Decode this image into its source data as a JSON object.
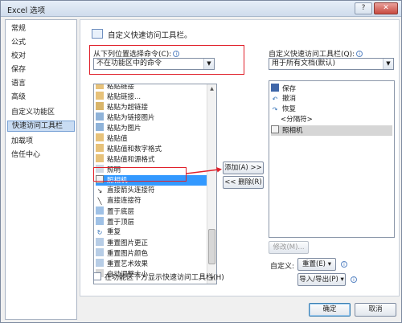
{
  "window": {
    "title": "Excel 选项",
    "help_glyph": "?",
    "close_glyph": "✕"
  },
  "sidebar": {
    "items": [
      {
        "label": "常规"
      },
      {
        "label": "公式"
      },
      {
        "label": "校对"
      },
      {
        "label": "保存"
      },
      {
        "label": "语言"
      },
      {
        "label": "高级"
      },
      {
        "label": "自定义功能区"
      },
      {
        "label": "快速访问工具栏",
        "active": true
      },
      {
        "label": "加载项"
      },
      {
        "label": "信任中心"
      }
    ]
  },
  "main": {
    "header_title": "自定义快速访问工具栏。",
    "choose_label": "从下列位置选择命令(C):",
    "choose_value": "不在功能区中的命令",
    "customize_label": "自定义快速访问工具栏(Q):",
    "customize_value": "用于所有文档(默认)",
    "commands": [
      {
        "label": "粘贴链接",
        "icon": "paste-link-icon"
      },
      {
        "label": "粘贴链接...",
        "icon": "paste-link-icon"
      },
      {
        "label": "粘贴为超链接",
        "icon": "paste-hyperlink-icon"
      },
      {
        "label": "粘贴为链接图片",
        "icon": "paste-picture-link-icon"
      },
      {
        "label": "粘贴为图片",
        "icon": "paste-picture-icon"
      },
      {
        "label": "粘贴值",
        "icon": "paste-values-icon"
      },
      {
        "label": "粘贴值和数字格式",
        "icon": "paste-values-number-icon"
      },
      {
        "label": "粘贴值和源格式",
        "icon": "paste-values-source-icon"
      },
      {
        "label": "照明",
        "icon": "lighting-icon"
      },
      {
        "label": "照相机",
        "icon": "camera-icon",
        "selected": true
      },
      {
        "label": "直接箭头连接符",
        "icon": "straight-arrow-connector-icon"
      },
      {
        "label": "直接连接符",
        "icon": "straight-connector-icon"
      },
      {
        "label": "置于底层",
        "icon": "send-to-back-icon"
      },
      {
        "label": "置于顶层",
        "icon": "bring-to-front-icon"
      },
      {
        "label": "重复",
        "icon": "repeat-icon"
      },
      {
        "label": "重置图片更正",
        "icon": "reset-picture-correction-icon"
      },
      {
        "label": "重置图片颜色",
        "icon": "reset-picture-color-icon"
      },
      {
        "label": "重置艺术效果",
        "icon": "reset-artistic-effects-icon"
      },
      {
        "label": "自动调整大小",
        "icon": "autofit-icon"
      }
    ],
    "toolbar_items": [
      {
        "label": "保存",
        "icon": "save-icon"
      },
      {
        "label": "撤消",
        "icon": "undo-icon"
      },
      {
        "label": "恢复",
        "icon": "redo-icon"
      },
      {
        "label": "<分隔符>",
        "icon": ""
      },
      {
        "label": "照相机",
        "icon": "camera-icon",
        "selected": true
      }
    ],
    "add_label": "添加(A) >>",
    "remove_label": "<< 删除(R)",
    "modify_label": "修改(M)...",
    "customize_text": "自定义:",
    "reset_label": "重置(E) ▾",
    "import_export_label": "导入/导出(P) ▾",
    "show_below_label": "在功能区下方显示快速访问工具栏(H)",
    "info_glyph": "i"
  },
  "footer": {
    "ok_label": "确定",
    "cancel_label": "取消"
  },
  "colors": {
    "selection": "#3399ff",
    "highlight_annotation": "#e0202a",
    "sidebar_active": "#c9dcf3"
  }
}
